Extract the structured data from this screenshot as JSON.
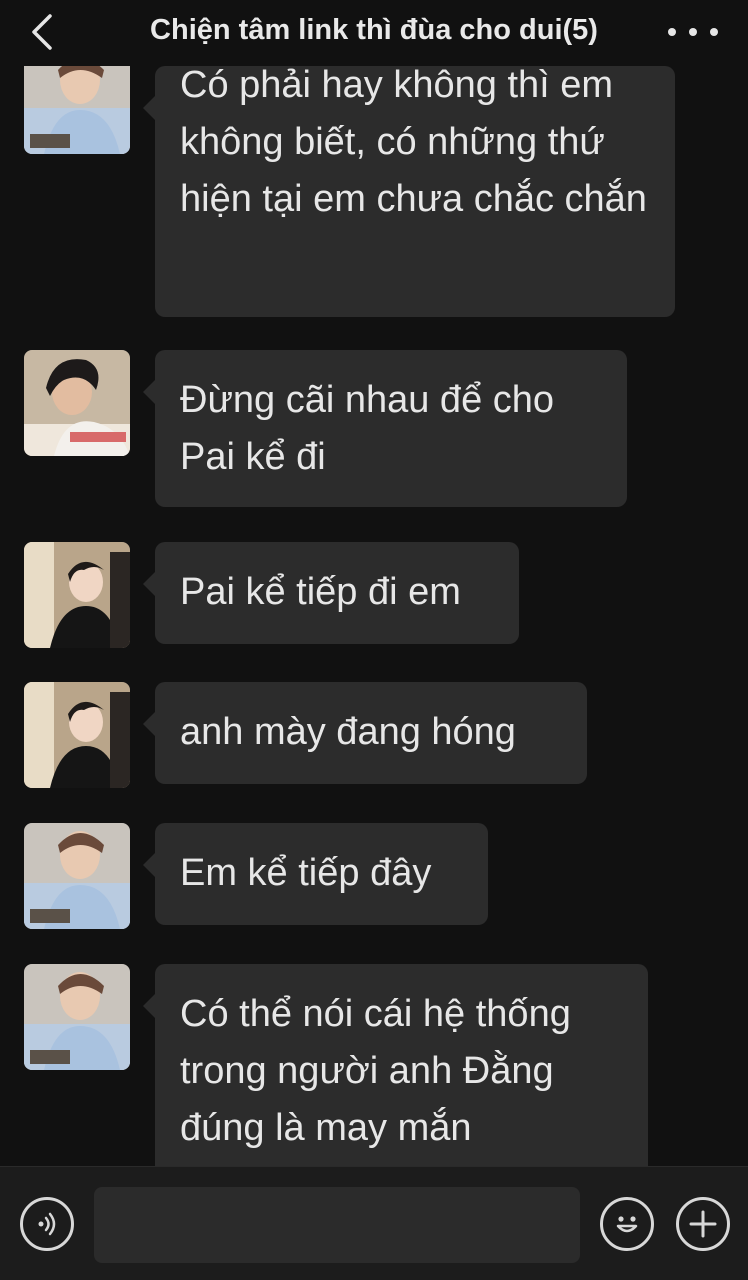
{
  "header": {
    "back_icon": "chevron-left-icon",
    "title": "Chiện tâm link thì đùa cho dui(5)",
    "more_icon": "more-horizontal-icon"
  },
  "messages": [
    {
      "avatar": "avatar-boy-blue-shirt",
      "text": "Có phải hay không thì em không biết, có những thứ hiện tại em chưa chắc chắn"
    },
    {
      "avatar": "avatar-boy-reading",
      "text": "Đừng cãi nhau để cho Pai kể đi"
    },
    {
      "avatar": "avatar-boy-black-shirt",
      "text": "Pai kể tiếp đi em"
    },
    {
      "avatar": "avatar-boy-black-shirt",
      "text": "anh mày đang hóng"
    },
    {
      "avatar": "avatar-boy-blue-shirt",
      "text": "Em kể tiếp đây"
    },
    {
      "avatar": "avatar-boy-blue-shirt",
      "text": "Có thể nói cái hệ thống trong người anh Đằng đúng là may mắn"
    }
  ],
  "input_bar": {
    "voice_icon": "voice-icon",
    "input_value": "",
    "emoji_icon": "emoji-icon",
    "plus_icon": "plus-icon"
  },
  "colors": {
    "background": "#111111",
    "bubble": "#2c2c2c",
    "text": "#e7e7e7",
    "input_bar": "#1c1c1c"
  }
}
